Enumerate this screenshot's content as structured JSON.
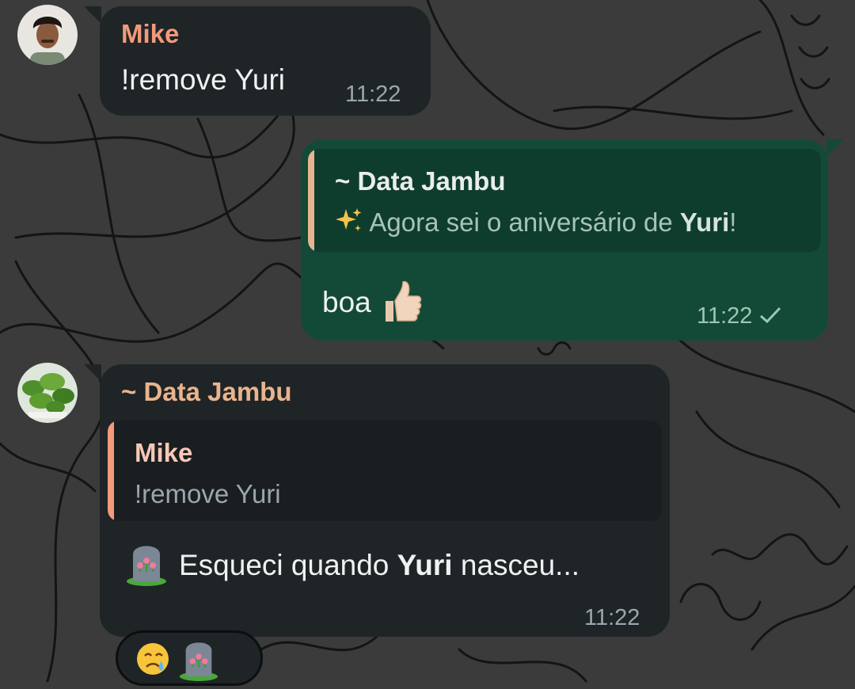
{
  "colors": {
    "chat_background": "#3b3b3b",
    "incoming_bubble": "#1f2427",
    "outgoing_bubble": "#134a37",
    "mike_name": "#f29a7c",
    "data_jambu_name": "#e9b48d",
    "quote_bar_data_jambu": "#e6b48e",
    "quote_bar_mike": "#f29a7c"
  },
  "messages": [
    {
      "sender": "Mike",
      "avatar_icon": "person-avatar-icon",
      "text": "!remove Yuri",
      "time": "11:22"
    },
    {
      "direction": "outgoing",
      "quoted": {
        "sender": "~ Data Jambu",
        "emoji_icon": "sparkles-icon",
        "text_before": "Agora sei o aniversário de",
        "text_bold": "Yuri",
        "text_after": "!"
      },
      "text": "boa",
      "emoji_icon": "thumbs-up-icon",
      "time": "11:22",
      "status_icon": "single-check-icon"
    },
    {
      "sender": "~ Data Jambu",
      "avatar_icon": "plant-avatar-icon",
      "quoted": {
        "sender": "Mike",
        "text": "!remove Yuri"
      },
      "emoji_icon": "headstone-icon",
      "text_before": "Esqueci quando",
      "text_bold": "Yuri",
      "text_after": "nasceu...",
      "time": "11:22",
      "reactions": [
        "crying-face-icon",
        "headstone-icon"
      ]
    }
  ]
}
